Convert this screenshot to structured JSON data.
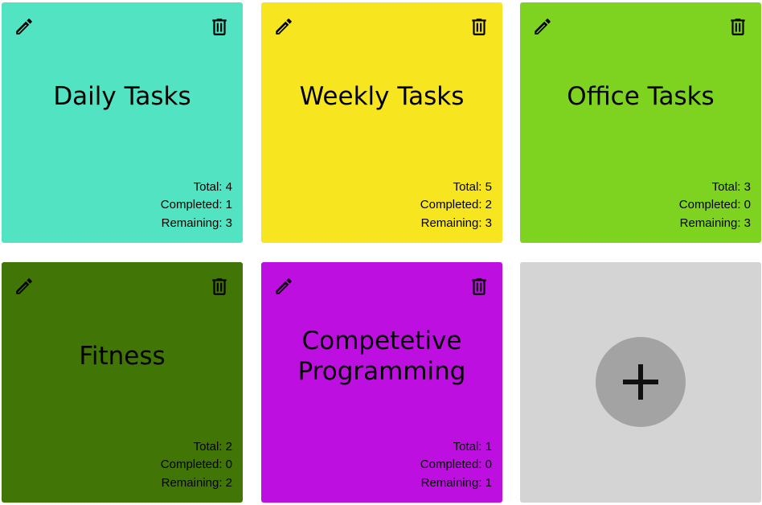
{
  "cards": [
    {
      "title": "Daily Tasks",
      "color": "#52e3c2",
      "total_label": "Total: ",
      "total": "4",
      "completed_label": "Completed: ",
      "completed": "1",
      "remaining_label": "Remaining: ",
      "remaining": "3"
    },
    {
      "title": "Weekly Tasks",
      "color": "#f7e51f",
      "total_label": "Total: ",
      "total": "5",
      "completed_label": "Completed: ",
      "completed": "2",
      "remaining_label": "Remaining: ",
      "remaining": "3"
    },
    {
      "title": "Office Tasks",
      "color": "#7ed321",
      "total_label": "Total: ",
      "total": "3",
      "completed_label": "Completed: ",
      "completed": "0",
      "remaining_label": "Remaining: ",
      "remaining": "3"
    },
    {
      "title": "Fitness",
      "color": "#417505",
      "total_label": "Total: ",
      "total": "2",
      "completed_label": "Completed: ",
      "completed": "0",
      "remaining_label": "Remaining: ",
      "remaining": "2"
    },
    {
      "title": "Competetive Programming",
      "color": "#bd10e0",
      "total_label": "Total: ",
      "total": "1",
      "completed_label": "Completed: ",
      "completed": "0",
      "remaining_label": "Remaining: ",
      "remaining": "1"
    }
  ],
  "icons": {
    "edit": "pencil-icon",
    "delete": "trash-icon",
    "add": "plus-icon"
  },
  "add_card": {
    "color": "#d4d4d4",
    "button_color": "#a3a3a3"
  }
}
